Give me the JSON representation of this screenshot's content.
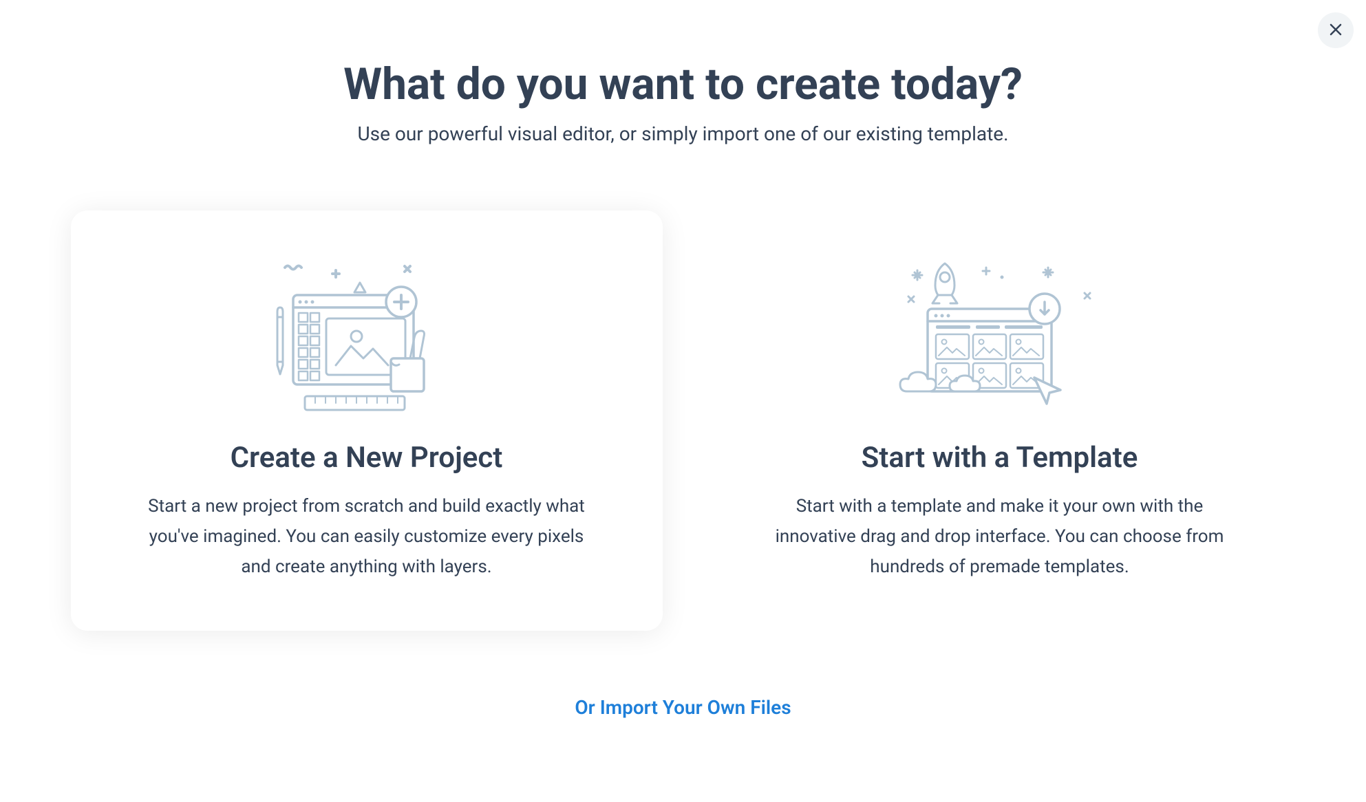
{
  "header": {
    "title": "What do you want to create today?",
    "subtitle": "Use our powerful visual editor, or simply import one of our existing template."
  },
  "options": {
    "create": {
      "title": "Create a New Project",
      "description": "Start a new project from scratch and build exactly what you've imagined. You can easily customize every pixels and create anything with layers."
    },
    "template": {
      "title": "Start with a Template",
      "description": "Start with a template and make it your own with the innovative drag and drop interface. You can choose from hundreds of premade templates."
    }
  },
  "footer": {
    "import_link": "Or Import Your Own Files"
  },
  "colors": {
    "text_primary": "#334155",
    "link": "#1e7fd9",
    "illustration_stroke": "#b0c4d4",
    "close_bg": "#f1f4f6"
  }
}
